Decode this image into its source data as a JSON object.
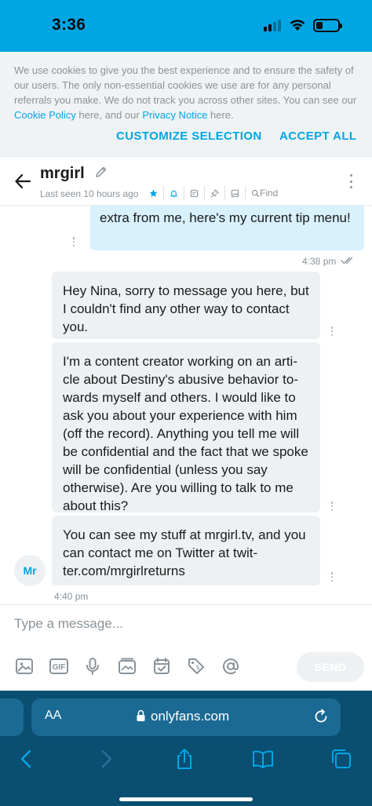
{
  "status_bar": {
    "time": "3:36"
  },
  "cookie_banner": {
    "text_before_policy": "We use cookies to give you the best experience and to ensure the safety of our users. The only non-essential cookies we use are for any personal referrals you make. We do not track you across other sites. You can see our ",
    "cookie_policy_link": "Cookie Policy",
    "text_middle": " here, and our ",
    "privacy_notice_link": "Privacy Notice",
    "text_after": " here.",
    "customize_label": "CUSTOMIZE SELECTION",
    "accept_label": "ACCEPT ALL"
  },
  "chat_header": {
    "username": "mrgirl",
    "last_seen": "Last seen 10 hours ago",
    "find_label": "Find"
  },
  "messages": {
    "outgoing_text": "extra from me, here's my current tip menu!",
    "outgoing_time": "4:38 pm",
    "incoming": [
      "Hey Nina, sorry to message you here, but I couldn't find any other way to con­tact you.",
      "I'm a content creator working on an arti­cle about Destiny's abusive behavior to­wards myself and others. I would like to ask you about your experience with him (off the record). Anything you tell me will be confidential and the fact that we spoke will be confidential (unless you say otherwise). Are you willing to talk to me about this?",
      "You can see my stuff at mrgirl.tv, and you can contact me on Twitter at twit­ter.com/mrgirlreturns"
    ],
    "incoming_time": "4:40 pm",
    "avatar_initials": "Mr"
  },
  "composer": {
    "placeholder": "Type a message...",
    "gif_label": "GIF",
    "send_label": "SEND"
  },
  "safari": {
    "aa_label": "AA",
    "url": "onlyfans.com"
  },
  "colors": {
    "accent": "#00a6e4",
    "outgoing_bubble": "#d8f1fc",
    "incoming_bubble": "#eef1f3",
    "safari_bar": "#0a4e72"
  }
}
